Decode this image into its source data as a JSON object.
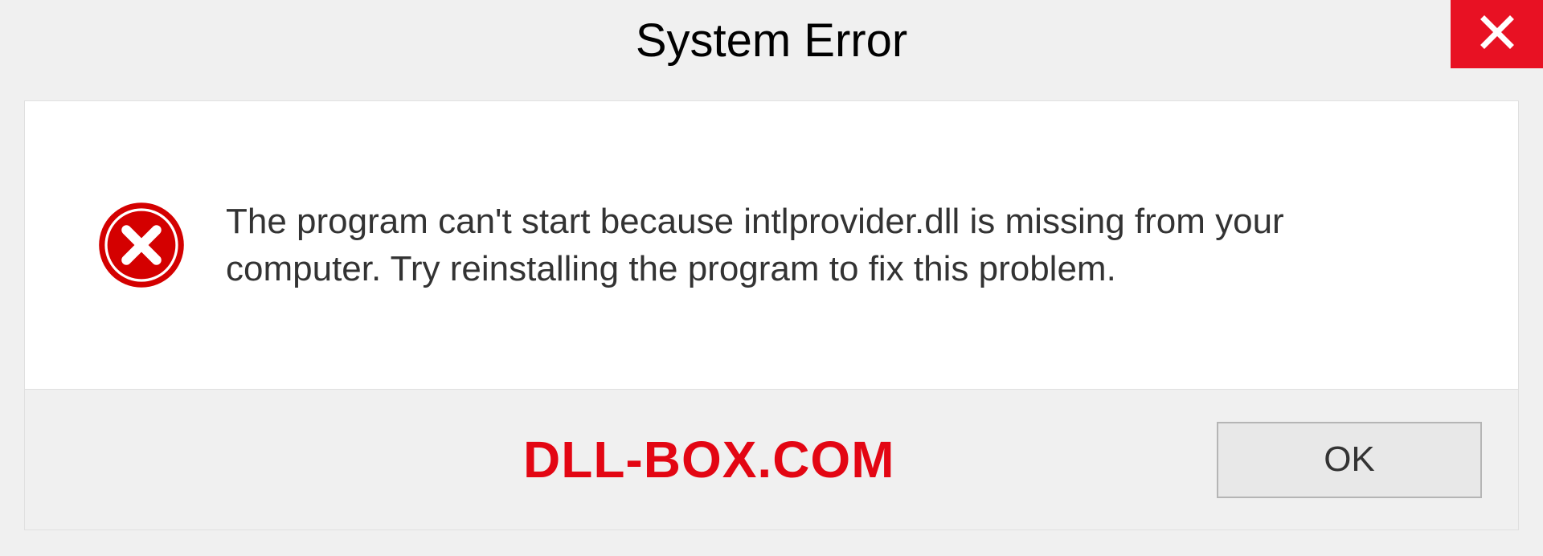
{
  "titlebar": {
    "title": "System Error"
  },
  "content": {
    "message": "The program can't start because intlprovider.dll is missing from your computer. Try reinstalling the program to fix this problem."
  },
  "footer": {
    "watermark": "DLL-BOX.COM",
    "ok_label": "OK"
  },
  "colors": {
    "close_bg": "#e81123",
    "error_red": "#d40000",
    "watermark_red": "#e30613"
  }
}
